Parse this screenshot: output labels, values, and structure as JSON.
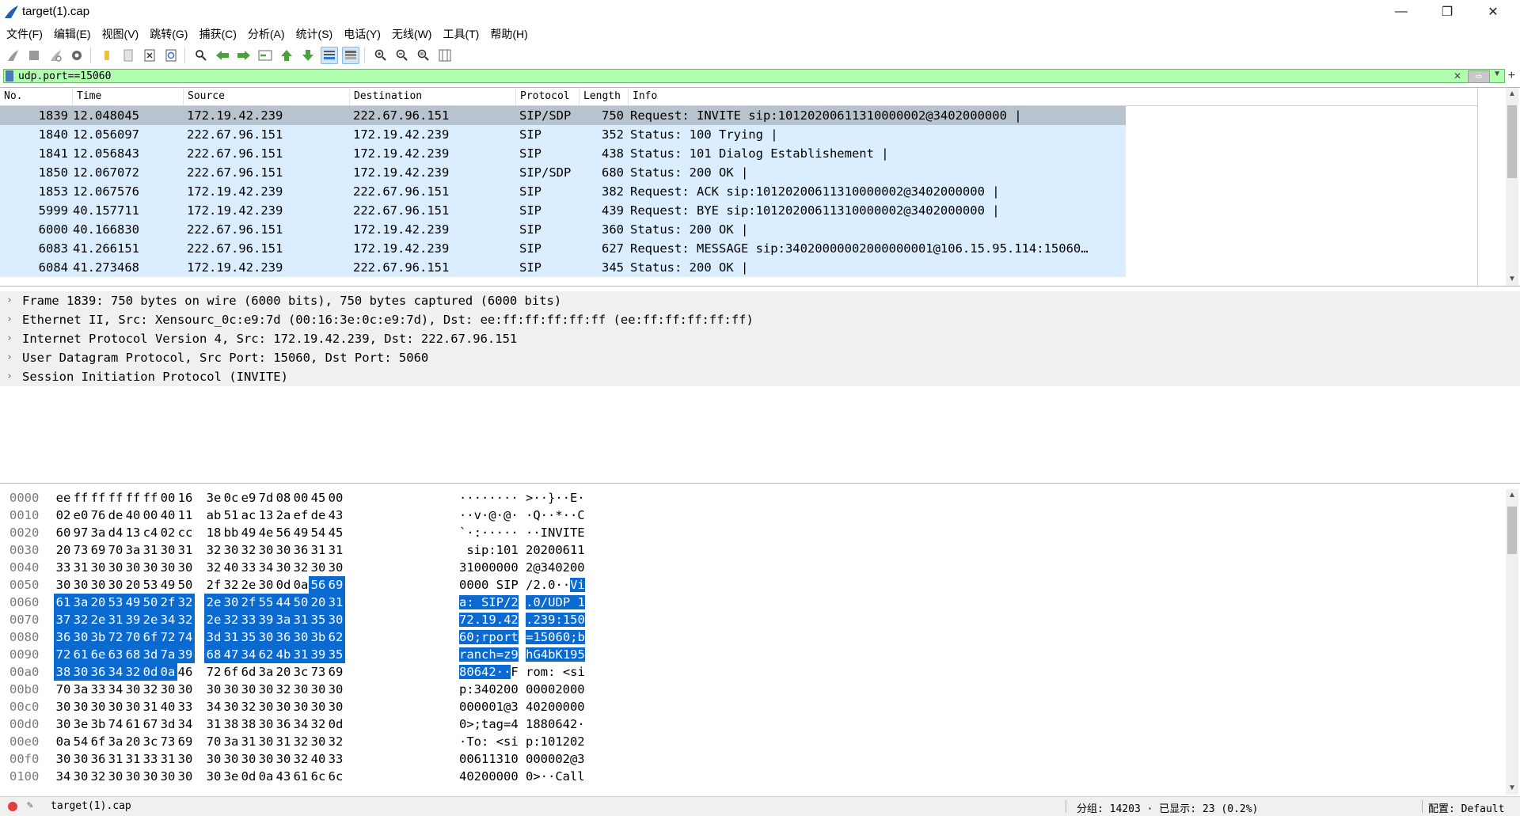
{
  "window": {
    "title": "target(1).cap",
    "minimize": "—",
    "restore": "❐",
    "close": "✕"
  },
  "menu": [
    "文件(F)",
    "编辑(E)",
    "视图(V)",
    "跳转(G)",
    "捕获(C)",
    "分析(A)",
    "统计(S)",
    "电话(Y)",
    "无线(W)",
    "工具(T)",
    "帮助(H)"
  ],
  "toolbar_icons": [
    "shark-fin-start-icon",
    "stop-square-icon",
    "restart-icon",
    "capture-options-gear-icon",
    "open-folder-icon",
    "file-icon",
    "close-file-x-icon",
    "reload-icon",
    "find-magnifier-icon",
    "back-arrow-icon",
    "forward-arrow-icon",
    "go-to-packet-icon",
    "first-packet-icon",
    "last-packet-icon",
    "autoscroll-icon",
    "colorize-icon",
    "zoom-in-icon",
    "zoom-out-icon",
    "normal-size-icon",
    "resize-columns-icon"
  ],
  "filter": {
    "value": "udp.port==15060"
  },
  "packet_list": {
    "columns": [
      "No.",
      "Time",
      "Source",
      "Destination",
      "Protocol",
      "Length",
      "Info"
    ],
    "rows": [
      {
        "no": "1839",
        "time": "12.048045",
        "src": "172.19.42.239",
        "dst": "222.67.96.151",
        "proto": "SIP/SDP",
        "len": "750",
        "info": "Request: INVITE sip:10120200611310000002@3402000000 |"
      },
      {
        "no": "1840",
        "time": "12.056097",
        "src": "222.67.96.151",
        "dst": "172.19.42.239",
        "proto": "SIP",
        "len": "352",
        "info": "Status: 100 Trying |"
      },
      {
        "no": "1841",
        "time": "12.056843",
        "src": "222.67.96.151",
        "dst": "172.19.42.239",
        "proto": "SIP",
        "len": "438",
        "info": "Status: 101 Dialog Establishement |"
      },
      {
        "no": "1850",
        "time": "12.067072",
        "src": "222.67.96.151",
        "dst": "172.19.42.239",
        "proto": "SIP/SDP",
        "len": "680",
        "info": "Status: 200 OK |"
      },
      {
        "no": "1853",
        "time": "12.067576",
        "src": "172.19.42.239",
        "dst": "222.67.96.151",
        "proto": "SIP",
        "len": "382",
        "info": "Request: ACK sip:10120200611310000002@3402000000 |"
      },
      {
        "no": "5999",
        "time": "40.157711",
        "src": "172.19.42.239",
        "dst": "222.67.96.151",
        "proto": "SIP",
        "len": "439",
        "info": "Request: BYE sip:10120200611310000002@3402000000 |"
      },
      {
        "no": "6000",
        "time": "40.166830",
        "src": "222.67.96.151",
        "dst": "172.19.42.239",
        "proto": "SIP",
        "len": "360",
        "info": "Status: 200 OK |"
      },
      {
        "no": "6083",
        "time": "41.266151",
        "src": "222.67.96.151",
        "dst": "172.19.42.239",
        "proto": "SIP",
        "len": "627",
        "info": "Request: MESSAGE sip:34020000002000000001@106.15.95.114:15060…"
      },
      {
        "no": "6084",
        "time": "41.273468",
        "src": "172.19.42.239",
        "dst": "222.67.96.151",
        "proto": "SIP",
        "len": "345",
        "info": "Status: 200 OK |"
      }
    ]
  },
  "details": [
    "Frame 1839: 750 bytes on wire (6000 bits), 750 bytes captured (6000 bits)",
    "Ethernet II, Src: Xensourc_0c:e9:7d (00:16:3e:0c:e9:7d), Dst: ee:ff:ff:ff:ff:ff (ee:ff:ff:ff:ff:ff)",
    "Internet Protocol Version 4, Src: 172.19.42.239, Dst: 222.67.96.151",
    "User Datagram Protocol, Src Port: 15060, Dst Port: 5060",
    "Session Initiation Protocol (INVITE)"
  ],
  "bytes": [
    {
      "off": "0000",
      "hex": [
        "ee",
        "ff",
        "ff",
        "ff",
        "ff",
        "ff",
        "00",
        "16",
        "3e",
        "0c",
        "e9",
        "7d",
        "08",
        "00",
        "45",
        "00"
      ],
      "ascii": "········ >··}··E·",
      "hl": []
    },
    {
      "off": "0010",
      "hex": [
        "02",
        "e0",
        "76",
        "de",
        "40",
        "00",
        "40",
        "11",
        "ab",
        "51",
        "ac",
        "13",
        "2a",
        "ef",
        "de",
        "43"
      ],
      "ascii": "··v·@·@· ·Q··*··C",
      "hl": []
    },
    {
      "off": "0020",
      "hex": [
        "60",
        "97",
        "3a",
        "d4",
        "13",
        "c4",
        "02",
        "cc",
        "18",
        "bb",
        "49",
        "4e",
        "56",
        "49",
        "54",
        "45"
      ],
      "ascii": "`·:····· ··INVITE",
      "hl": []
    },
    {
      "off": "0030",
      "hex": [
        "20",
        "73",
        "69",
        "70",
        "3a",
        "31",
        "30",
        "31",
        "32",
        "30",
        "32",
        "30",
        "30",
        "36",
        "31",
        "31"
      ],
      "ascii": " sip:101 20200611",
      "hl": []
    },
    {
      "off": "0040",
      "hex": [
        "33",
        "31",
        "30",
        "30",
        "30",
        "30",
        "30",
        "30",
        "32",
        "40",
        "33",
        "34",
        "30",
        "32",
        "30",
        "30"
      ],
      "ascii": "31000000 2@340200",
      "hl": []
    },
    {
      "off": "0050",
      "hex": [
        "30",
        "30",
        "30",
        "30",
        "20",
        "53",
        "49",
        "50",
        "2f",
        "32",
        "2e",
        "30",
        "0d",
        "0a",
        "56",
        "69"
      ],
      "ascii": "0000 SIP /2.0··Vi",
      "hl": [
        14,
        15
      ]
    },
    {
      "off": "0060",
      "hex": [
        "61",
        "3a",
        "20",
        "53",
        "49",
        "50",
        "2f",
        "32",
        "2e",
        "30",
        "2f",
        "55",
        "44",
        "50",
        "20",
        "31"
      ],
      "ascii": "a: SIP/2 .0/UDP 1",
      "hl": [
        0,
        1,
        2,
        3,
        4,
        5,
        6,
        7,
        8,
        9,
        10,
        11,
        12,
        13,
        14,
        15
      ]
    },
    {
      "off": "0070",
      "hex": [
        "37",
        "32",
        "2e",
        "31",
        "39",
        "2e",
        "34",
        "32",
        "2e",
        "32",
        "33",
        "39",
        "3a",
        "31",
        "35",
        "30"
      ],
      "ascii": "72.19.42 .239:150",
      "hl": [
        0,
        1,
        2,
        3,
        4,
        5,
        6,
        7,
        8,
        9,
        10,
        11,
        12,
        13,
        14,
        15
      ]
    },
    {
      "off": "0080",
      "hex": [
        "36",
        "30",
        "3b",
        "72",
        "70",
        "6f",
        "72",
        "74",
        "3d",
        "31",
        "35",
        "30",
        "36",
        "30",
        "3b",
        "62"
      ],
      "ascii": "60;rport =15060;b",
      "hl": [
        0,
        1,
        2,
        3,
        4,
        5,
        6,
        7,
        8,
        9,
        10,
        11,
        12,
        13,
        14,
        15
      ]
    },
    {
      "off": "0090",
      "hex": [
        "72",
        "61",
        "6e",
        "63",
        "68",
        "3d",
        "7a",
        "39",
        "68",
        "47",
        "34",
        "62",
        "4b",
        "31",
        "39",
        "35"
      ],
      "ascii": "ranch=z9 hG4bK195",
      "hl": [
        0,
        1,
        2,
        3,
        4,
        5,
        6,
        7,
        8,
        9,
        10,
        11,
        12,
        13,
        14,
        15
      ]
    },
    {
      "off": "00a0",
      "hex": [
        "38",
        "30",
        "36",
        "34",
        "32",
        "0d",
        "0a",
        "46",
        "72",
        "6f",
        "6d",
        "3a",
        "20",
        "3c",
        "73",
        "69"
      ],
      "ascii": "80642··F rom: <si",
      "hl": [
        0,
        1,
        2,
        3,
        4,
        5,
        6
      ]
    },
    {
      "off": "00b0",
      "hex": [
        "70",
        "3a",
        "33",
        "34",
        "30",
        "32",
        "30",
        "30",
        "30",
        "30",
        "30",
        "30",
        "32",
        "30",
        "30",
        "30"
      ],
      "ascii": "p:340200 00002000",
      "hl": []
    },
    {
      "off": "00c0",
      "hex": [
        "30",
        "30",
        "30",
        "30",
        "30",
        "31",
        "40",
        "33",
        "34",
        "30",
        "32",
        "30",
        "30",
        "30",
        "30",
        "30"
      ],
      "ascii": "000001@3 40200000",
      "hl": []
    },
    {
      "off": "00d0",
      "hex": [
        "30",
        "3e",
        "3b",
        "74",
        "61",
        "67",
        "3d",
        "34",
        "31",
        "38",
        "38",
        "30",
        "36",
        "34",
        "32",
        "0d"
      ],
      "ascii": "0>;tag=4 1880642·",
      "hl": []
    },
    {
      "off": "00e0",
      "hex": [
        "0a",
        "54",
        "6f",
        "3a",
        "20",
        "3c",
        "73",
        "69",
        "70",
        "3a",
        "31",
        "30",
        "31",
        "32",
        "30",
        "32"
      ],
      "ascii": "·To: <si p:101202",
      "hl": []
    },
    {
      "off": "00f0",
      "hex": [
        "30",
        "30",
        "36",
        "31",
        "31",
        "33",
        "31",
        "30",
        "30",
        "30",
        "30",
        "30",
        "30",
        "32",
        "40",
        "33"
      ],
      "ascii": "00611310 000002@3",
      "hl": []
    },
    {
      "off": "0100",
      "hex": [
        "34",
        "30",
        "32",
        "30",
        "30",
        "30",
        "30",
        "30",
        "30",
        "3e",
        "0d",
        "0a",
        "43",
        "61",
        "6c",
        "6c"
      ],
      "ascii": "40200000 0>··Call",
      "hl": []
    }
  ],
  "status": {
    "file": "target(1).cap",
    "packets": "分组: 14203 · 已显示: 23 (0.2%)",
    "profile": "配置: Default"
  },
  "colors": {
    "row_bg": "#daeeff",
    "selected_row_bg": "#b9c3cf",
    "filter_ok_bg": "#afffaf",
    "byte_highlight": "#0a6ad0"
  }
}
